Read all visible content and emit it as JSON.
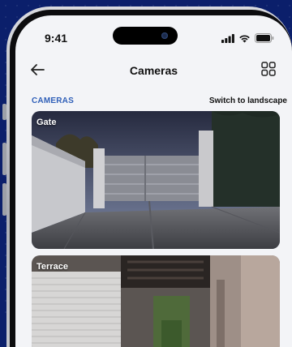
{
  "status_bar": {
    "time": "9:41"
  },
  "nav": {
    "title": "Cameras"
  },
  "section": {
    "label": "CAMERAS",
    "switch_label": "Switch to landscape"
  },
  "cameras": [
    {
      "name": "Gate"
    },
    {
      "name": "Terrace"
    }
  ],
  "colors": {
    "background": "#0b1f6b",
    "accent": "#2f5fb8",
    "screen": "#f3f4f7"
  },
  "icons": {
    "back": "arrow-left-icon",
    "layout": "grid-view-icon",
    "signal": "cellular-signal-icon",
    "wifi": "wifi-icon",
    "battery": "battery-icon"
  }
}
